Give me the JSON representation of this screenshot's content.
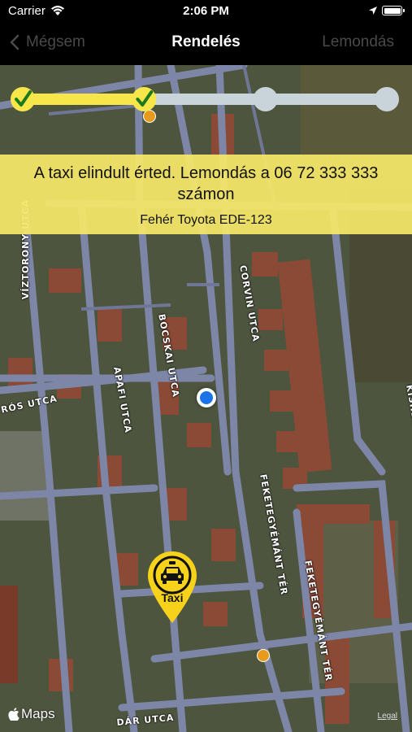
{
  "status_bar": {
    "carrier": "Carrier",
    "time": "2:06 PM"
  },
  "nav": {
    "back_label": "Mégsem",
    "title": "Rendelés",
    "right_label": "Lemondás"
  },
  "progress": {
    "completed_steps": 2,
    "total_steps": 4,
    "fill_color": "#f7e64a",
    "track_color": "#c9d3da"
  },
  "info": {
    "message": "A taxi elindult érted. Lemondás a 06 72 333 333 számon",
    "car": "Fehér Toyota EDE-123"
  },
  "map": {
    "streets": {
      "viztorony": "VÍZTORONY UTCA",
      "corvin": "CORVIN UTCA",
      "bocskai": "BOCSKAI UTCA",
      "kishegyi": "KISHEGYI DŰLŐ",
      "ros": "RÓS UTCA",
      "apafi": "APAFI UTCA",
      "feketegyemant1": "FEKETEGYÉMÁNT TÉR",
      "feketegyemant2": "FEKETEGYÉMÁNT TÉR",
      "dar": "DÁR UTCA"
    },
    "taxi_label": "Taxi",
    "brand": "Maps",
    "legal": "Legal"
  },
  "colors": {
    "accent_yellow": "#f5e768",
    "pin_yellow": "#f7d21a",
    "user_blue": "#1a73e8"
  }
}
